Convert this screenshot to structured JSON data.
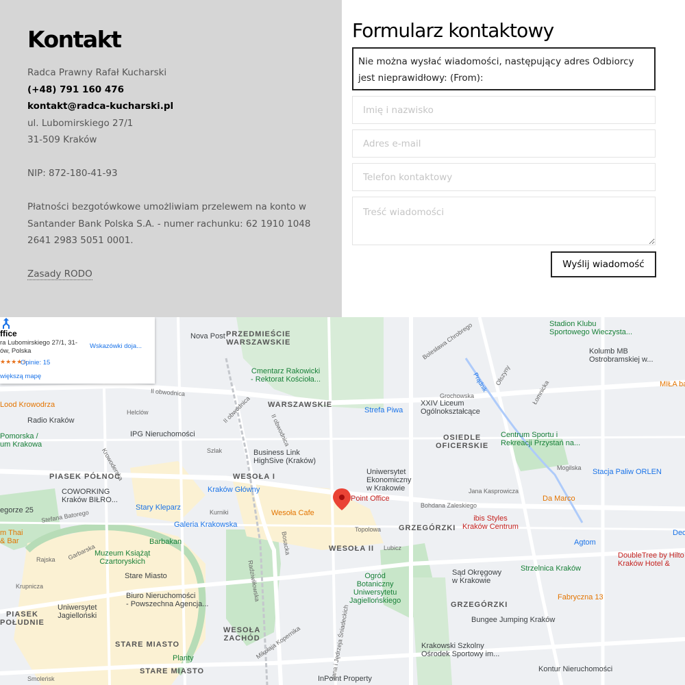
{
  "contact": {
    "title": "Kontakt",
    "name": "Radca Prawny Rafał Kucharski",
    "phone": "(+48) 791 160 476",
    "email": "kontakt@radca-kucharski.pl",
    "street": "ul. Lubomirskiego 27/1",
    "city": "31-509 Kraków",
    "nip": "NIP: 872-180-41-93",
    "payment": "Płatności bezgotówkowe umożliwiam przelewem na konto w Santander Bank Polska S.A. - numer rachunku: 62 1910 1048 2641 2983 5051 0001.",
    "rodo_link": "Zasady RODO"
  },
  "form": {
    "title": "Formularz kontaktowy",
    "error": "Nie można wysłać wiadomości, następujący adres Odbiorcy jest nieprawidłowy: (From):",
    "name_placeholder": "Imię i nazwisko",
    "email_placeholder": "Adres e-mail",
    "phone_placeholder": "Telefon kontaktowy",
    "message_placeholder": "Treść wiadomości",
    "submit_label": "Wyślij wiadomość"
  },
  "map": {
    "card": {
      "title": "ffice",
      "address": "ra Lubomirskiego 27/1, 31-\nów, Polska",
      "stars": "★★★★☆",
      "rating": "Opinie: 15",
      "enlarge": "większą mapę",
      "directions": "Wskazówki doja..."
    },
    "labels": {
      "nova_post": "Nova Post",
      "przedmiescie": "PRZEDMIEŚCIE\nWARSZAWSKIE",
      "cmentarz": "Cmentarz Rakowicki\n- Rektorat Kościoła...",
      "warszawskie": "WARSZAWSKIE",
      "strefa_piwa": "Strefa Piwa",
      "liceum": "XXIV Liceum\nOgólnokształcące",
      "osiedle": "OSIEDLE\nOFICERSKIE",
      "centrum_sportu": "Centrum Sportu i\nRekreacji Przystań na...",
      "stadion": "Stadion Klubu\nSportowego Wieczysta...",
      "kolumbu": "Kolumb MB\nOstrobramskiej w...",
      "mila": "MIŁA ba",
      "orlen": "Stacja Paliw ORLEN",
      "lood": "Lood Krowodrza",
      "radio": "Radio Kraków",
      "pomorska": "Pomorska /\num Krakowa",
      "ipg": "IPG Nieruchomości",
      "business_link": "Business Link\nHighSive (Kraków)",
      "uniwersytet_ek": "Uniwersytet\nEkonomiczny\nw Krakowie",
      "piasek_polnoc": "PIASEK PÓŁNOC",
      "wesola_i": "WESOŁA I",
      "coworking": "COWORKING\nKraków BIŁRO...",
      "krakow_glowny": "Kraków Główny",
      "point_office": "Point Office",
      "wesola_cafe": "Wesoła Cafe",
      "dmarco": "Da Marco",
      "ibis": "ibis Styles\nKraków Centrum",
      "egorzki": "GRZEGÓRZKI",
      "agtom": "Agtom",
      "doubletree": "DoubleTree by Hilto\nKraków Hotel &",
      "stary_kleparz": "Stary Kleparz",
      "galeria": "Galeria Krakowska",
      "egorze25": "egorze 25",
      "wesola_ii": "WESOŁA II",
      "thai": "m Thai\n& Bar",
      "barbakan": "Barbakan",
      "muzeum": "Muzeum Książąt\nCzartoryskich",
      "stare_miasto_pin": "Stare Miasto",
      "ogrod": "Ogród\nBotaniczny\nUniwersytetu\nJagiellońskiego",
      "sad": "Sąd Okręgowy\nw Krakowie",
      "strzelnica": "Strzelnica Kraków",
      "biuro": "Biuro Nieruchomości\n- Powszechna Agencja...",
      "piasek_poludnie": "PIASEK\nPOŁUDNIE",
      "uniwersytet_jag": "Uniwersytet\nJagielloński",
      "stare_miasto": "STARE MIASTO",
      "wesola_zachod": "WESOŁA\nZACHÓD",
      "grzegorzki": "GRZEGÓRZKI",
      "fabryczna": "Fabryczna 13",
      "bungee": "Bungee Jumping Kraków",
      "krakowski_szkolny": "Krakowski Szkolny\nOśrodek Sportowy im...",
      "stare_miasto2": "STARE MIASTO",
      "planty": "Planty",
      "inpoint": "InPoint Property",
      "kontur": "Kontur Nieruchomości",
      "dec": "Dec",
      "helclow": "Helclów",
      "ii_obwodnica": "II obwodnica",
      "ii_obwodnica2": "II obwodnica",
      "krowoderska": "Krowoderska",
      "szlak": "Szlak",
      "kurniki": "Kurniki",
      "lubicz": "Lubicz",
      "topolowa": "Topolowa",
      "garbarska": "Garbarska",
      "rajska": "Rajska",
      "krupnicza": "Krupnicza",
      "smolensk": "Smoleńsk",
      "grochowska": "Grochowska",
      "kasprowicza": "Jana Kasprowicza",
      "zaleskiego": "Bohdana Zaleskiego",
      "mogilska": "Mogilska",
      "pradnik": "Prądnik",
      "olszyny": "Olszyny",
      "stefana": "Stefana Batorego",
      "obwodnica_top": "Il obwodnica",
      "mikolaja": "Mikołaja Kopernika",
      "radziwillowska": "Radziwiłłowska",
      "bosacka": "Bosacka",
      "sniadeckich": "Jana i Jędrzeja Śniadeckich",
      "chrobrego": "Bolesława Chrobrego",
      "lomnicka": "Łomnicka"
    }
  }
}
